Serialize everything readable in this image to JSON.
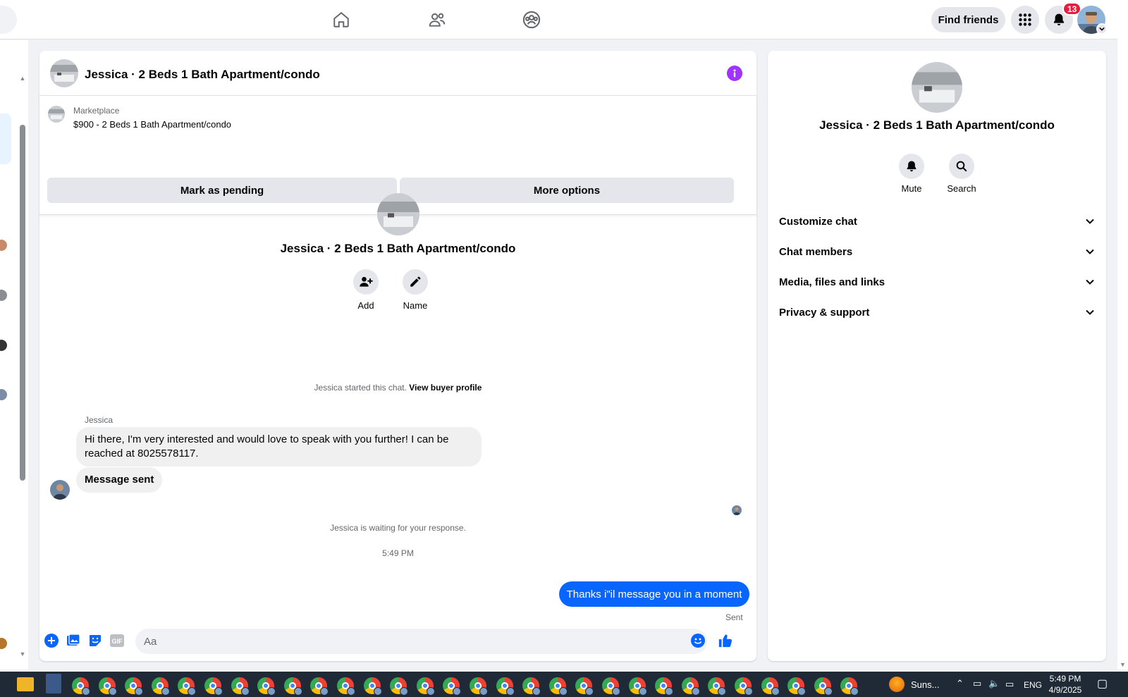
{
  "topbar": {
    "find_friends_label": "Find friends",
    "notification_count": "13",
    "nav_icons": [
      "home-icon",
      "friends-icon",
      "groups-icon"
    ]
  },
  "chat": {
    "header_title": "Jessica · 2 Beds 1 Bath Apartment/condo",
    "marketplace_label": "Marketplace",
    "listing_price_title": "$900 - 2 Beds 1 Bath Apartment/condo",
    "mark_pending_label": "Mark as pending",
    "more_options_label": "More options",
    "intro_title": "Jessica · 2 Beds 1 Bath Apartment/condo",
    "add_label": "Add",
    "name_label": "Name",
    "started_text": "Jessica started this chat.",
    "view_buyer_label": "View buyer profile",
    "sender_name": "Jessica",
    "messages": [
      {
        "text": "Hi there, I'm very interested and would love to speak with you further! I can be reached at 8025578117."
      },
      {
        "text": "Message sent"
      }
    ],
    "waiting_text": "Jessica is waiting for your response.",
    "timestamp": "5:49 PM",
    "outgoing_message": "Thanks i\"il message you in a moment",
    "outgoing_status": "Sent",
    "composer_placeholder": "Aa",
    "gif_label": "GIF"
  },
  "info_panel": {
    "title": "Jessica · 2 Beds 1 Bath Apartment/condo",
    "mute_label": "Mute",
    "search_label": "Search",
    "sections": [
      "Customize chat",
      "Chat members",
      "Media, files and links",
      "Privacy & support"
    ]
  },
  "taskbar": {
    "weather_text": "Suns...",
    "language": "ENG",
    "time": "5:49 PM",
    "date": "4/9/2025"
  },
  "colors": {
    "accent_blue": "#0866ff",
    "info_purple": "#a033ff",
    "badge_red": "#e41e3f"
  }
}
